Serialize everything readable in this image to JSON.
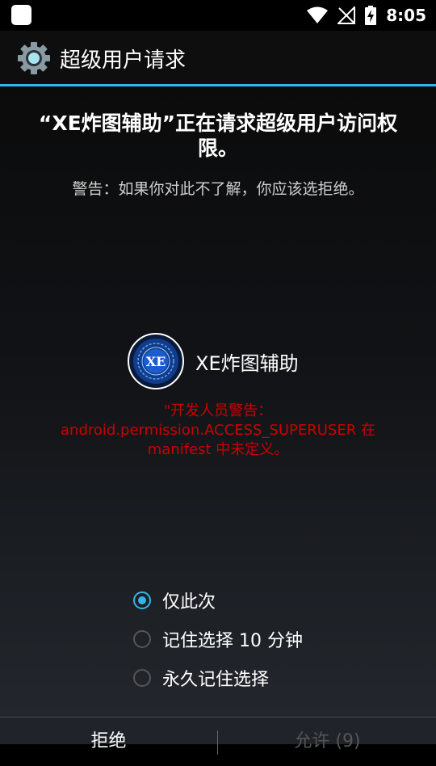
{
  "status_bar": {
    "time": "8:05"
  },
  "action_bar": {
    "title": "超级用户请求"
  },
  "request": {
    "heading": "“XE炸图辅助”正在请求超级用户访问权限。",
    "warning": "警告：如果你对此不了解，你应该选拒绝。"
  },
  "app": {
    "name": "XE炸图辅助",
    "logo_text": "XE"
  },
  "developer_warning": {
    "line1": "\"开发人员警告：",
    "line2": "android.permission.ACCESS_SUPERUSER 在",
    "line3": "manifest 中未定义。"
  },
  "options": [
    {
      "label": "仅此次",
      "checked": true
    },
    {
      "label": "记住选择 10 分钟",
      "checked": false
    },
    {
      "label": "永久记住选择",
      "checked": false
    }
  ],
  "buttons": {
    "deny": "拒绝",
    "allow": "允许 (9)"
  },
  "colors": {
    "accent": "#33b5e5",
    "warning_red": "#cc0000"
  }
}
